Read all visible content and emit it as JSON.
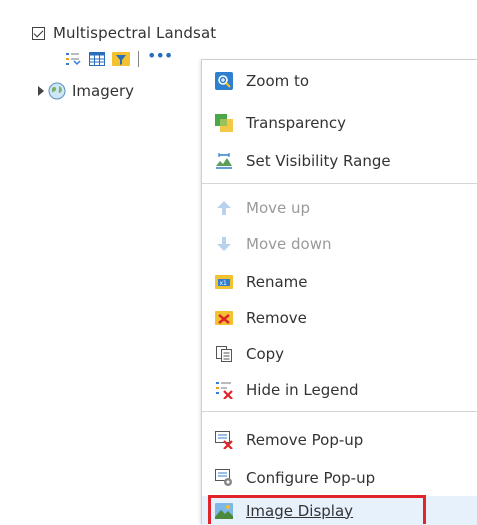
{
  "layer": {
    "title": "Multispectral Landsat",
    "checked": true
  },
  "toolbar": {
    "legend_icon": "legend-icon",
    "table_icon": "table-icon",
    "filter_icon": "filter-icon",
    "more_label": "•••"
  },
  "sublayer": {
    "title": "Imagery",
    "icon": "globe-icon"
  },
  "menu": {
    "zoom_to": "Zoom to",
    "transparency": "Transparency",
    "set_visibility_range": "Set Visibility Range",
    "move_up": "Move up",
    "move_down": "Move down",
    "rename": "Rename",
    "remove": "Remove",
    "copy": "Copy",
    "hide_in_legend": "Hide in Legend",
    "remove_popup": "Remove Pop-up",
    "configure_popup": "Configure Pop-up",
    "image_display": "Image Display"
  },
  "colors": {
    "highlight_border": "#e0242a",
    "highlight_bg": "#e6f1fb",
    "accent": "#2a6ebb"
  }
}
